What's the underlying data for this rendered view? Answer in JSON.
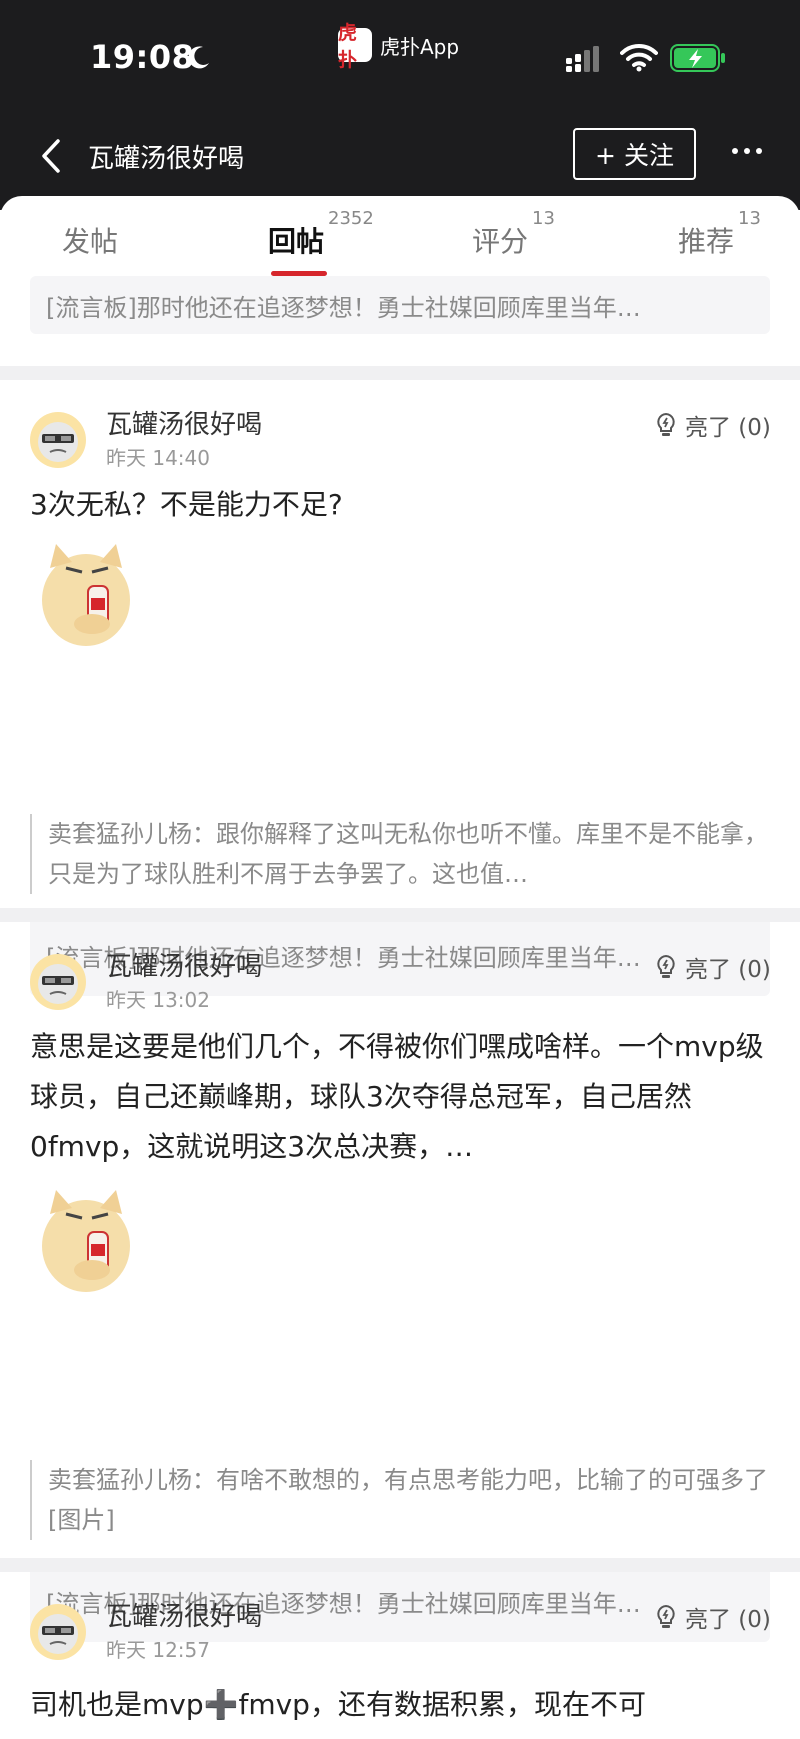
{
  "status_bar": {
    "time": "19:08",
    "app_icon_text": "虎扑",
    "app_name": "虎扑App",
    "icons": [
      "moon-icon",
      "cellular-signal-icon",
      "wifi-icon",
      "battery-charging-icon"
    ]
  },
  "nav": {
    "title": "瓦罐汤很好喝",
    "follow_label": "+ 关注",
    "icons": [
      "back-chevron-icon",
      "more-dots-icon"
    ]
  },
  "tabs": [
    {
      "label": "发帖",
      "count": ""
    },
    {
      "label": "回帖",
      "count": "2352"
    },
    {
      "label": "评分",
      "count": "13"
    },
    {
      "label": "推荐",
      "count": "13"
    }
  ],
  "top_link": "[流言板]那时他还在追逐梦想！勇士社媒回顾库里当年…",
  "posts": [
    {
      "user": "瓦罐汤很好喝",
      "time": "昨天 14:40",
      "light": "亮了 (0)",
      "text": "3次无私？不是能力不足?",
      "quote": "卖套猛孙儿杨：跟你解释了这叫无私你也听不懂。库里不是不能拿，只是为了球队胜利不屑于去争罢了。这也值…",
      "link": "[流言板]那时他还在追逐梦想！勇士社媒回顾库里当年…"
    },
    {
      "user": "瓦罐汤很好喝",
      "time": "昨天 13:02",
      "light": "亮了 (0)",
      "text": "意思是这要是他们几个，不得被你们嘿成啥样。一个mvp级球员，自己还巅峰期，球队3次夺得总冠军，自己居然0fmvp，这就说明这3次总决赛，…",
      "quote": "卖套猛孙儿杨：有啥不敢想的，有点思考能力吧，比输了的可强多了[图片]",
      "link": "[流言板]那时他还在追逐梦想！勇士社媒回顾库里当年…"
    },
    {
      "user": "瓦罐汤很好喝",
      "time": "昨天 12:57",
      "light": "亮了 (0)",
      "text": "司机也是mvp➕fmvp，还有数据积累，现在不可"
    }
  ],
  "colors": {
    "accent": "#d6262c",
    "header_bg": "#1c1c1e",
    "battery_green": "#35c759"
  }
}
